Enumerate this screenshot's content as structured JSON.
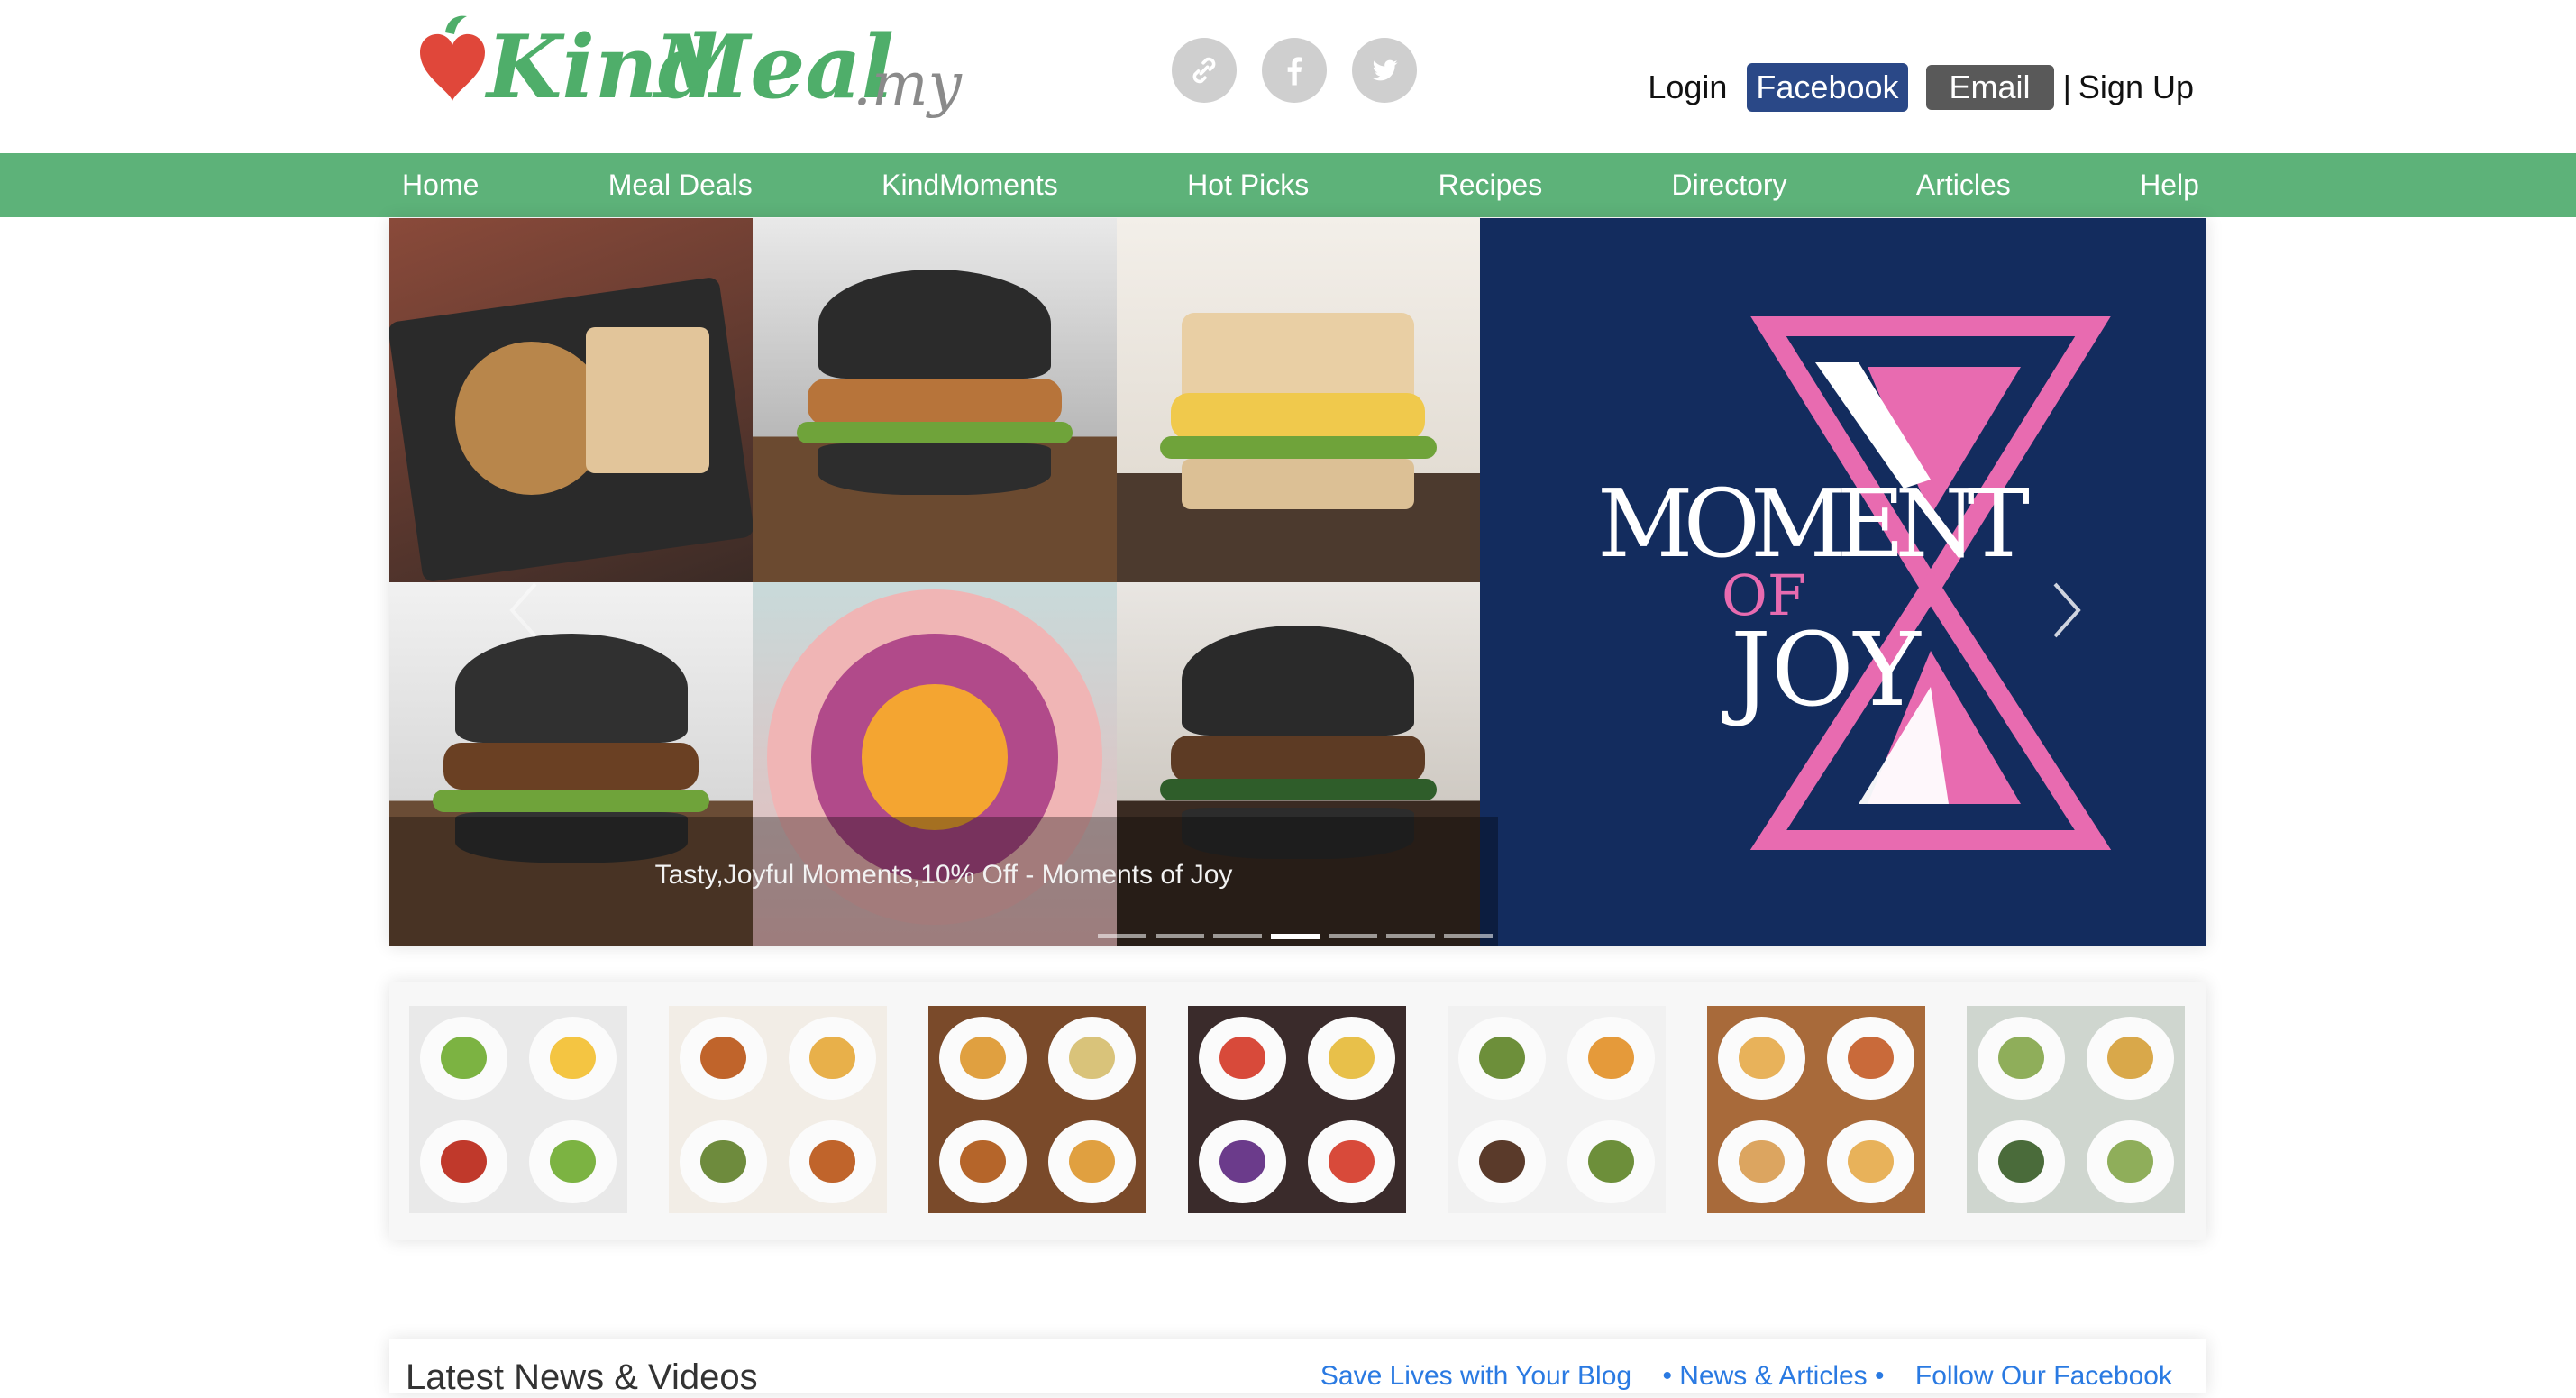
{
  "brand": {
    "logo_kind": "Kind",
    "logo_meal": "Meal",
    "logo_tld": ".my",
    "heart_color": "#e0473a",
    "green": "#5db279"
  },
  "social": [
    {
      "icon": "link-icon"
    },
    {
      "icon": "facebook-icon"
    },
    {
      "icon": "twitter-icon"
    }
  ],
  "auth": {
    "login": "Login",
    "facebook": "Facebook",
    "email": "Email",
    "separator": "|",
    "signup": "Sign Up"
  },
  "nav": [
    "Home",
    "Meal Deals",
    "KindMoments",
    "Hot Picks",
    "Recipes",
    "Directory",
    "Articles",
    "Help"
  ],
  "hero": {
    "caption": "Tasty,Joyful Moments,10% Off - Moments of Joy",
    "slide_count": 7,
    "active_slide": 4,
    "poster": {
      "line1": "Moment",
      "line2": "of",
      "line3": "Joy",
      "bg": "#132c5e",
      "accent": "#e86bb0"
    }
  },
  "thumbnails_count": 7,
  "news": {
    "title": "Latest News & Videos",
    "links": [
      "Save Lives with Your Blog",
      "• News & Articles •",
      "Follow Our Facebook"
    ]
  }
}
